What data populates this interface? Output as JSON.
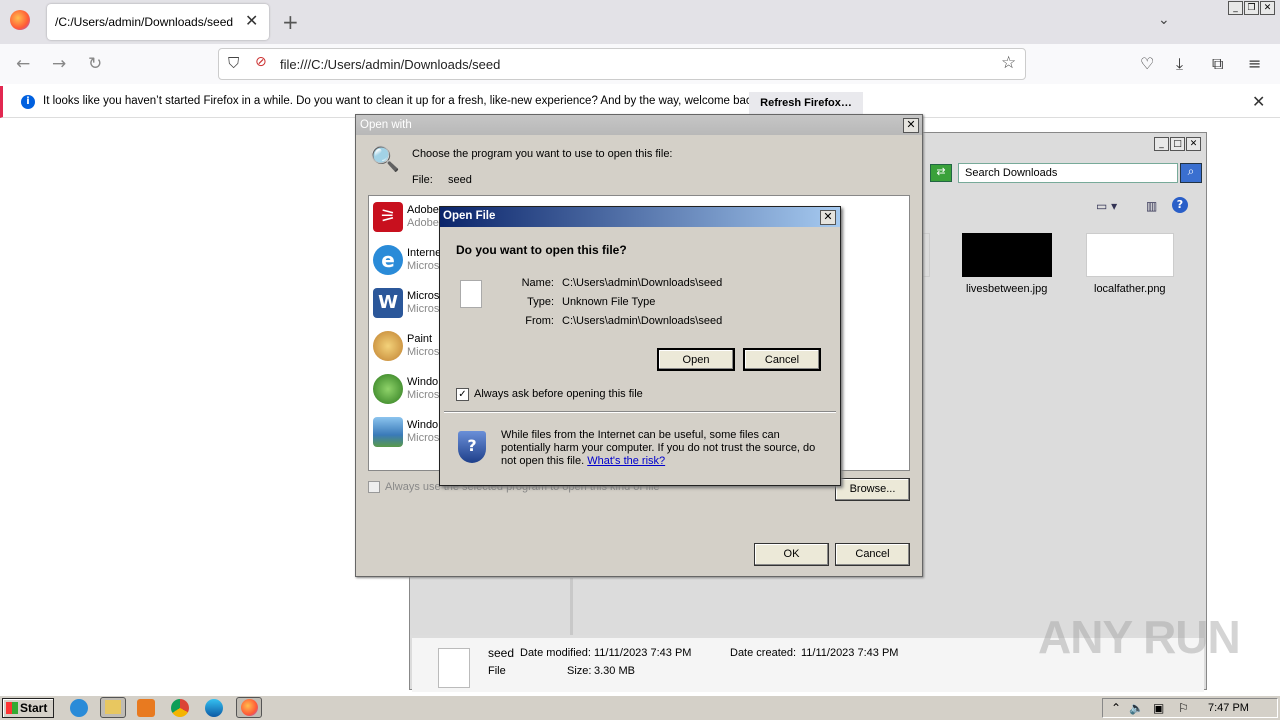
{
  "browser": {
    "tab_title": "/C:/Users/admin/Downloads/seed",
    "url": "file:///C:/Users/admin/Downloads/seed",
    "notification": "It looks like you haven’t started Firefox in a while. Do you want to clean it up for a fresh, like-new experience? And by the way, welcome back!",
    "refresh_label": "Refresh Firefox…"
  },
  "explorer": {
    "search_placeholder": "Search Downloads",
    "thumbs": [
      "livesbetween.jpg",
      "localfather.png"
    ],
    "details": {
      "name": "seed",
      "type": "File",
      "modified_label": "Date modified:",
      "modified": "11/11/2023 7:43 PM",
      "created_label": "Date created:",
      "created": "11/11/2023 7:43 PM",
      "size_label": "Size:",
      "size": "3.30 MB"
    }
  },
  "open_with": {
    "title": "Open with",
    "prompt": "Choose the program you want to use to open this file:",
    "file_label": "File:",
    "file_name": "seed",
    "programs": [
      {
        "name": "Adobe",
        "sub": "Adobe",
        "icon": "pdf-icon",
        "color": "#c8101e"
      },
      {
        "name": "Interne",
        "sub": "Micros",
        "icon": "ie-icon",
        "color": "#2a8bd8"
      },
      {
        "name": "Micros",
        "sub": "Micros",
        "icon": "word-icon",
        "color": "#2b579a"
      },
      {
        "name": "Paint",
        "sub": "Micros",
        "icon": "paint-icon",
        "color": "#e0b040"
      },
      {
        "name": "Windo",
        "sub": "Micros",
        "icon": "media-player-icon",
        "color": "#3c9a2c"
      },
      {
        "name": "Windo",
        "sub": "Micros",
        "icon": "photo-viewer-icon",
        "color": "#4a8ac8"
      }
    ],
    "always_use": "Always use the selected program to open this kind of file",
    "browse": "Browse...",
    "ok": "OK",
    "cancel": "Cancel"
  },
  "open_file": {
    "title": "Open File",
    "question": "Do you want to open this file?",
    "name_label": "Name:",
    "name": "C:\\Users\\admin\\Downloads\\seed",
    "type_label": "Type:",
    "type": "Unknown File Type",
    "from_label": "From:",
    "from": "C:\\Users\\admin\\Downloads\\seed",
    "open": "Open",
    "cancel": "Cancel",
    "always_ask": "Always ask before opening this file",
    "always_ask_checked": true,
    "warning": "While files from the Internet can be useful, some files can potentially harm your computer. If you do not trust the source, do not open this file.",
    "risk_link": "What's the risk?"
  },
  "taskbar": {
    "start": "Start",
    "clock": "7:47 PM"
  },
  "watermark": "ANY RUN"
}
